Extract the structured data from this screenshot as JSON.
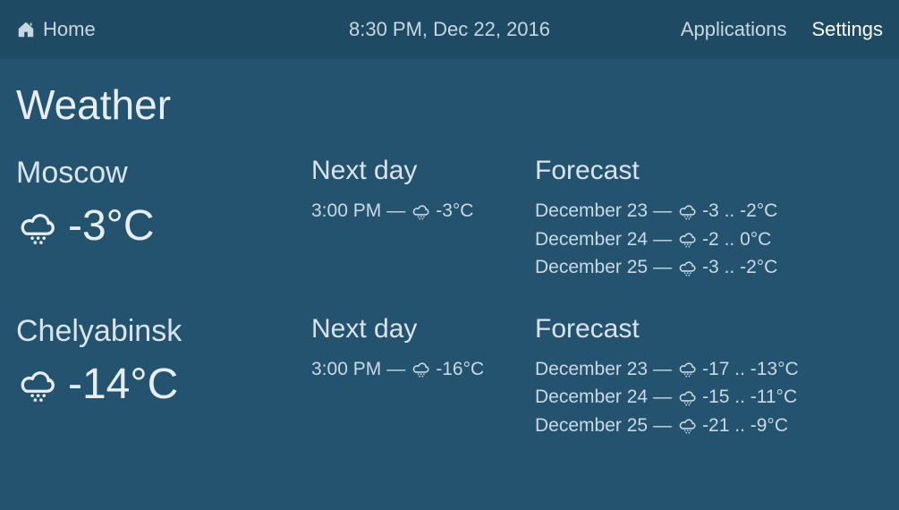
{
  "topbar": {
    "home_label": "Home",
    "datetime": "8:30 PM, Dec 22, 2016",
    "applications_label": "Applications",
    "settings_label": "Settings"
  },
  "page_title": "Weather",
  "labels": {
    "next_day": "Next day",
    "forecast": "Forecast",
    "dash": " — "
  },
  "cities": [
    {
      "name": "Moscow",
      "current_temp": "-3°C",
      "next_day": {
        "time": "3:00 PM",
        "temp": "-3°C"
      },
      "forecast": [
        {
          "date": "December 23",
          "range": "-3 .. -2°C"
        },
        {
          "date": "December 24",
          "range": "-2 .. 0°C"
        },
        {
          "date": "December 25",
          "range": "-3 .. -2°C"
        }
      ]
    },
    {
      "name": "Chelyabinsk",
      "current_temp": "-14°C",
      "next_day": {
        "time": "3:00 PM",
        "temp": "-16°C"
      },
      "forecast": [
        {
          "date": "December 23",
          "range": "-17 .. -13°C"
        },
        {
          "date": "December 24",
          "range": "-15 .. -11°C"
        },
        {
          "date": "December 25",
          "range": "-21 .. -9°C"
        }
      ]
    }
  ]
}
